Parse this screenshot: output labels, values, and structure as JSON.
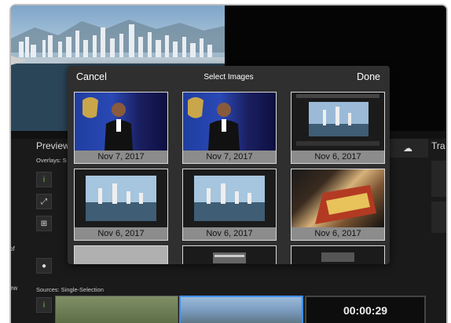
{
  "background": {
    "preview_label": "Preview",
    "overlays_label": "Overlays: S",
    "sources_label": "Sources:  Single-Selection",
    "edge_text_1": "of",
    "edge_text_2": "ew",
    "transitions_label": "Tra",
    "timer": "00:00:29",
    "icons": [
      "info-icon",
      "resize-icon",
      "layout-icon",
      "fill-icon",
      "cloud-upload-icon"
    ]
  },
  "picker": {
    "cancel_label": "Cancel",
    "title": "Select Images",
    "done_label": "Done",
    "images": [
      {
        "date": "Nov 7, 2017",
        "kind": "speaker-photo"
      },
      {
        "date": "Nov 7, 2017",
        "kind": "speaker-photo"
      },
      {
        "date": "Nov 6, 2017",
        "kind": "app-screenshot"
      },
      {
        "date": "Nov 6, 2017",
        "kind": "skyline-photo"
      },
      {
        "date": "Nov 6, 2017",
        "kind": "skyline-photo"
      },
      {
        "date": "Nov 6, 2017",
        "kind": "candy-photo"
      },
      {
        "date": "",
        "kind": "grey-placeholder"
      },
      {
        "date": "",
        "kind": "app-screenshot"
      },
      {
        "date": "",
        "kind": "app-screenshot"
      }
    ]
  },
  "colors": {
    "accent_blue": "#3f8ee8",
    "accent_green": "#7ec24b"
  }
}
